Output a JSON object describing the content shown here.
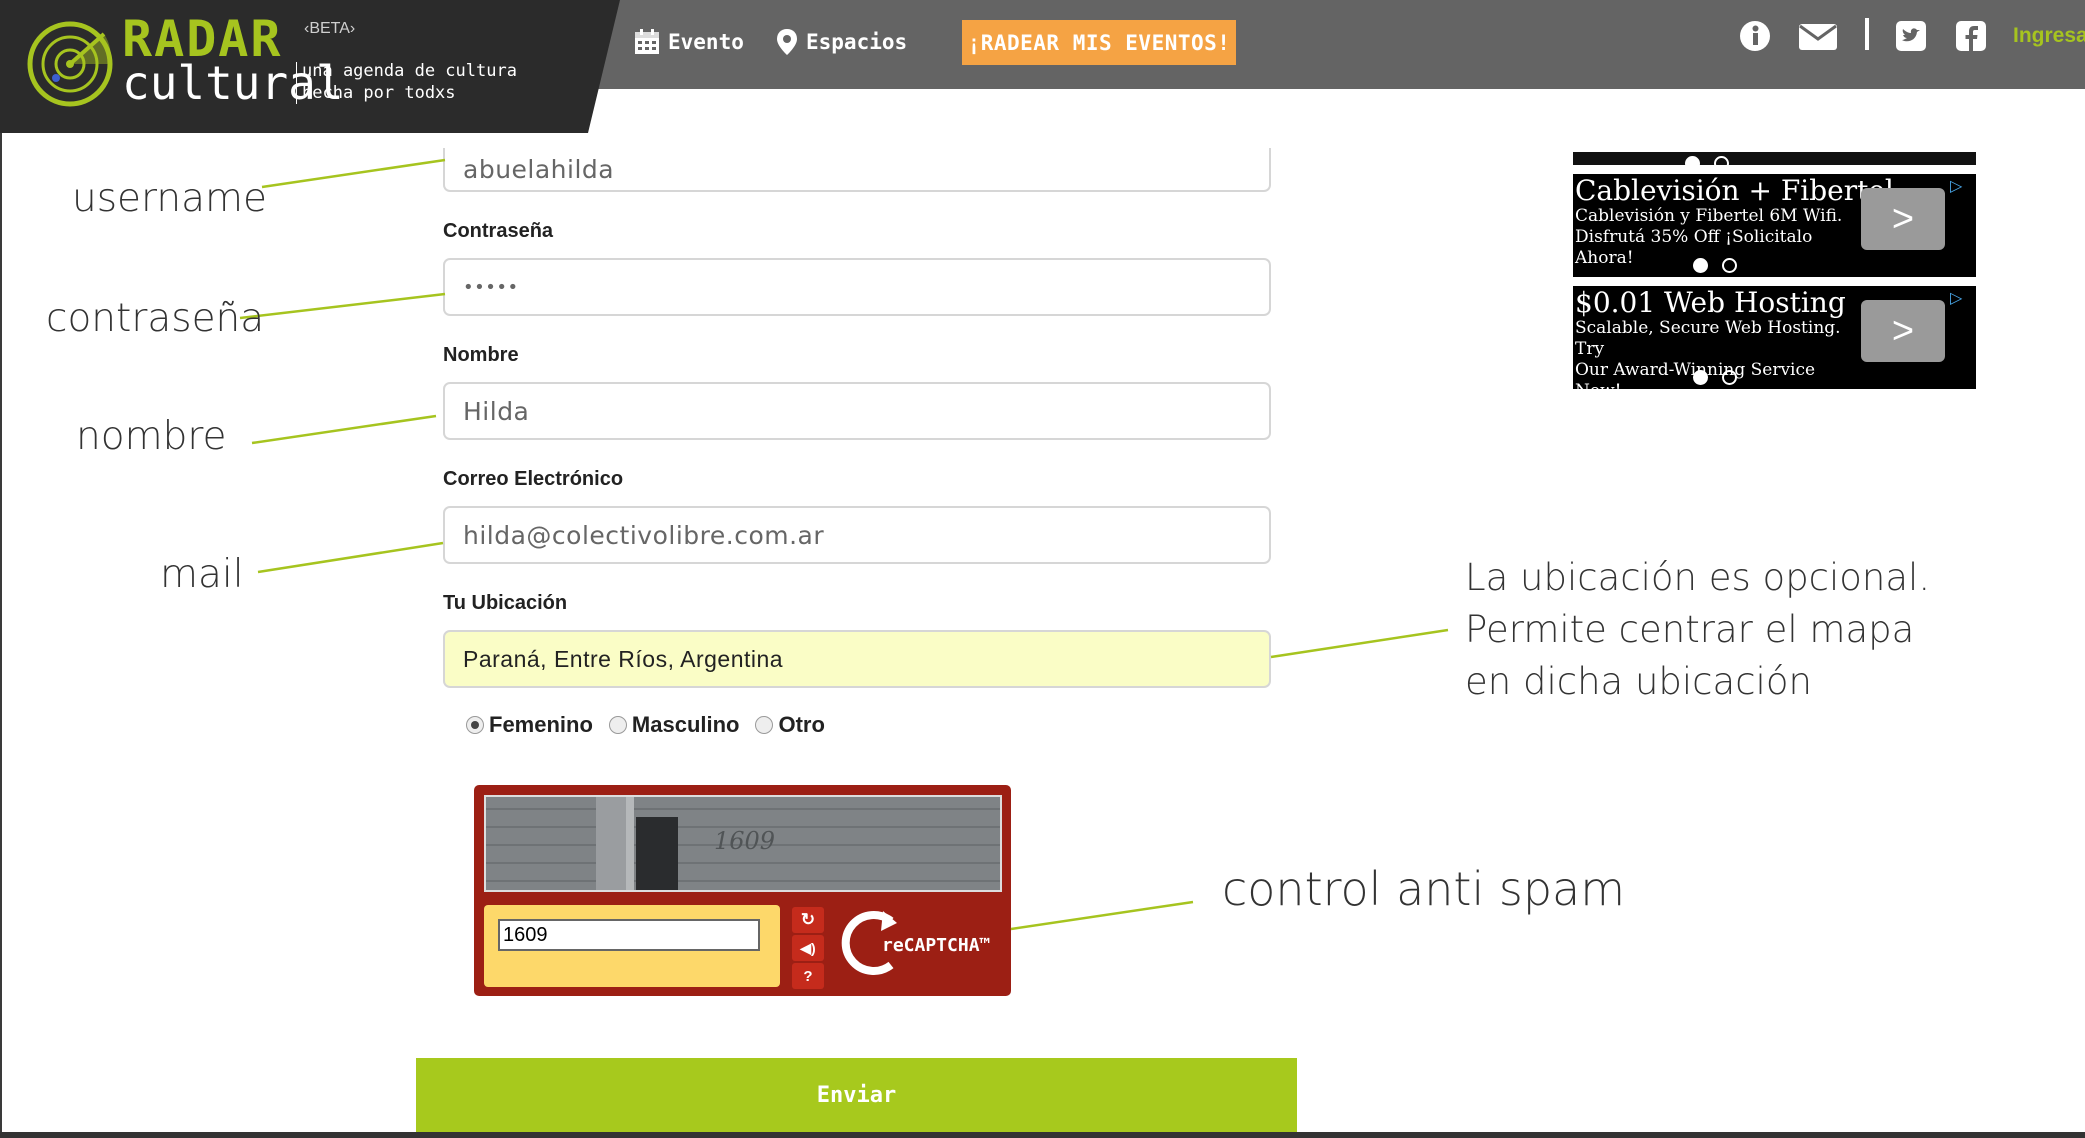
{
  "header": {
    "logo_title": "RADAR",
    "logo_subtitle": "cultural",
    "logo_beta": "‹BETA›",
    "tagline_line1": "una agenda de cultura",
    "tagline_line2": "hecha por todxs",
    "nav": [
      {
        "label": "Evento",
        "icon": "calendar-icon"
      },
      {
        "label": "Espacios",
        "icon": "map-pin-icon"
      }
    ],
    "cta_label": "¡RADEAR MIS EVENTOS!",
    "login_label": "Ingresar",
    "icons": [
      "info-icon",
      "mail-icon",
      "twitter-icon",
      "facebook-icon"
    ]
  },
  "form": {
    "username_value": "abuelahilda",
    "password_label": "Contraseña",
    "password_value": "•••••",
    "name_label": "Nombre",
    "name_value": "Hilda",
    "email_label": "Correo Electrónico",
    "email_value": "hilda@colectivolibre.com.ar",
    "location_label": "Tu Ubicación",
    "location_value": "Paraná, Entre Ríos, Argentina",
    "gender_options": [
      "Femenino",
      "Masculino",
      "Otro"
    ],
    "gender_selected": "Femenino",
    "captcha_answer": "1609",
    "captcha_image_text": "1609",
    "captcha_brand": "reCAPTCHA™",
    "submit_label": "Enviar"
  },
  "annotations": {
    "username": "username",
    "password": "contraseña",
    "name": "nombre",
    "mail": "mail",
    "location_line1": "La ubicación es opcional.",
    "location_line2": "Permite centrar el mapa",
    "location_line3": "en dicha ubicación",
    "captcha": "control anti spam"
  },
  "ads": [
    {
      "title": "Cablevisión + Fibertel",
      "line1": "Cablevisión y Fibertel 6M Wifi.",
      "line2": "Disfrutá 35% Off ¡Solicitalo Ahora!"
    },
    {
      "title": "$0.01 Web Hosting",
      "line1": "Scalable, Secure Web Hosting. Try",
      "line2": "Our Award-Winning Service Now!"
    }
  ],
  "colors": {
    "brand_green": "#a6c41f",
    "cta_orange": "#f5a344",
    "header_gray": "#646464",
    "captcha_red": "#9c1f14",
    "location_highlight": "#fafdc6"
  }
}
